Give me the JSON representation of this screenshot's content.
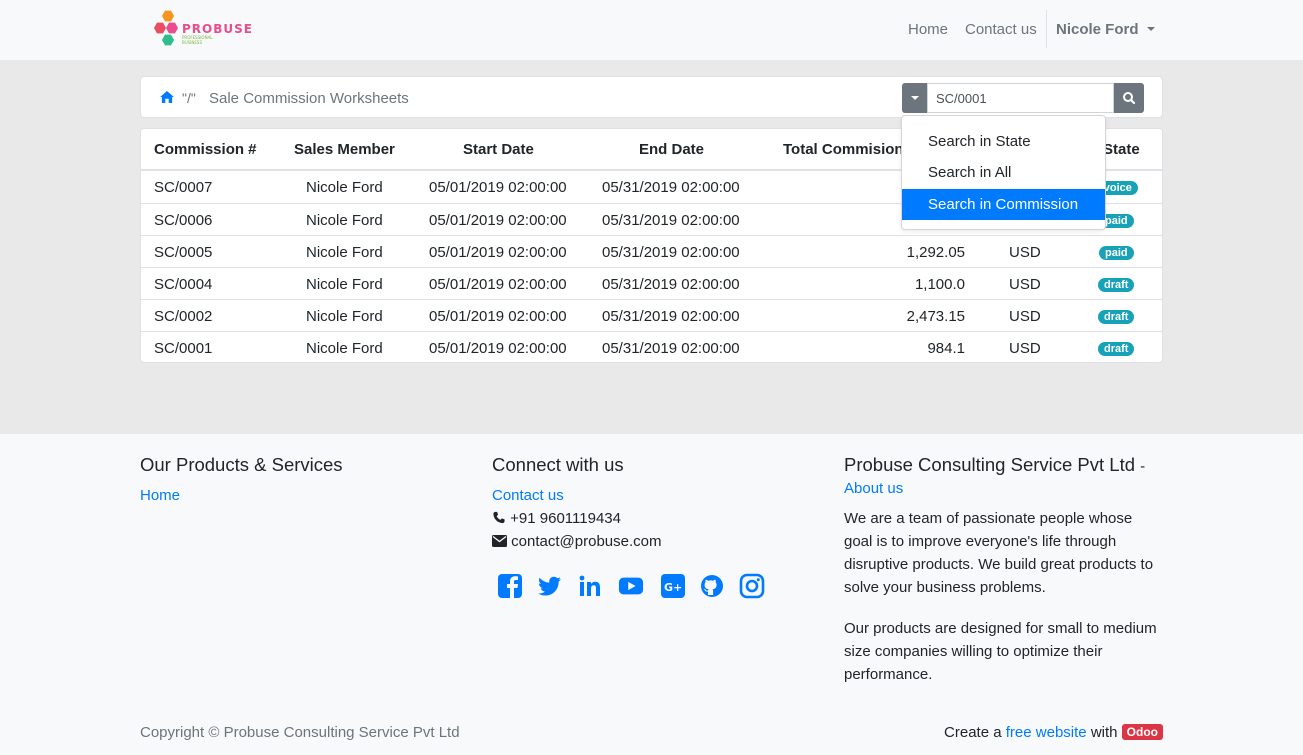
{
  "brand": {
    "logo_text": "PROBUSE",
    "tagline": "PROFESSIONAL BUSINESS"
  },
  "nav": {
    "home": "Home",
    "contact": "Contact us",
    "user": "Nicole Ford"
  },
  "breadcrumb": {
    "separator": "\"/\"",
    "current": "Sale Commission Worksheets"
  },
  "search": {
    "value": "SC/0001"
  },
  "dropdown": {
    "items": [
      {
        "label": "Search in State",
        "active": false
      },
      {
        "label": "Search in All",
        "active": false
      },
      {
        "label": "Search in Commission",
        "active": true
      }
    ]
  },
  "table": {
    "headers": [
      "Commission #",
      "Sales Member",
      "Start Date",
      "End Date",
      "Total Commision",
      "",
      "State"
    ],
    "rows": [
      {
        "id": "SC/0007",
        "member": "Nicole Ford",
        "start": "05/01/2019 02:00:00",
        "end": "05/31/2019 02:00:00",
        "total": "",
        "currency": "",
        "state": "invoice"
      },
      {
        "id": "SC/0006",
        "member": "Nicole Ford",
        "start": "05/01/2019 02:00:00",
        "end": "05/31/2019 02:00:00",
        "total": "",
        "currency": "",
        "state": "paid"
      },
      {
        "id": "SC/0005",
        "member": "Nicole Ford",
        "start": "05/01/2019 02:00:00",
        "end": "05/31/2019 02:00:00",
        "total": "1,292.05",
        "currency": "USD",
        "state": "paid"
      },
      {
        "id": "SC/0004",
        "member": "Nicole Ford",
        "start": "05/01/2019 02:00:00",
        "end": "05/31/2019 02:00:00",
        "total": "1,100.0",
        "currency": "USD",
        "state": "draft"
      },
      {
        "id": "SC/0002",
        "member": "Nicole Ford",
        "start": "05/01/2019 02:00:00",
        "end": "05/31/2019 02:00:00",
        "total": "2,473.15",
        "currency": "USD",
        "state": "draft"
      },
      {
        "id": "SC/0001",
        "member": "Nicole Ford",
        "start": "05/01/2019 02:00:00",
        "end": "05/31/2019 02:00:00",
        "total": "984.1",
        "currency": "USD",
        "state": "draft"
      }
    ]
  },
  "footer": {
    "products": {
      "title": "Our Products & Services",
      "home": "Home"
    },
    "connect": {
      "title": "Connect with us",
      "contact": "Contact us",
      "phone": "+91 9601119434",
      "email": "contact@probuse.com",
      "social": [
        "facebook-icon",
        "twitter-icon",
        "linkedin-icon",
        "youtube-icon",
        "google-plus-icon",
        "github-icon",
        "instagram-icon"
      ]
    },
    "about": {
      "title": "Probuse Consulting Service Pvt Ltd",
      "dash": "-",
      "about_link": "About us",
      "para1": "We are a team of passionate people whose goal is to improve everyone's life through disruptive products. We build great products to solve your business problems.",
      "para2": "Our products are designed for small to medium size companies willing to optimize their performance."
    },
    "copyright": "Copyright © Probuse Consulting Service Pvt Ltd",
    "create_prefix": "Create a",
    "create_link": "free website",
    "create_mid": "with",
    "odoo": "Odoo"
  },
  "colors": {
    "link": "#007bff",
    "badge": "#17a2b8",
    "active": "#007bff",
    "odoo": "#dc3545"
  }
}
